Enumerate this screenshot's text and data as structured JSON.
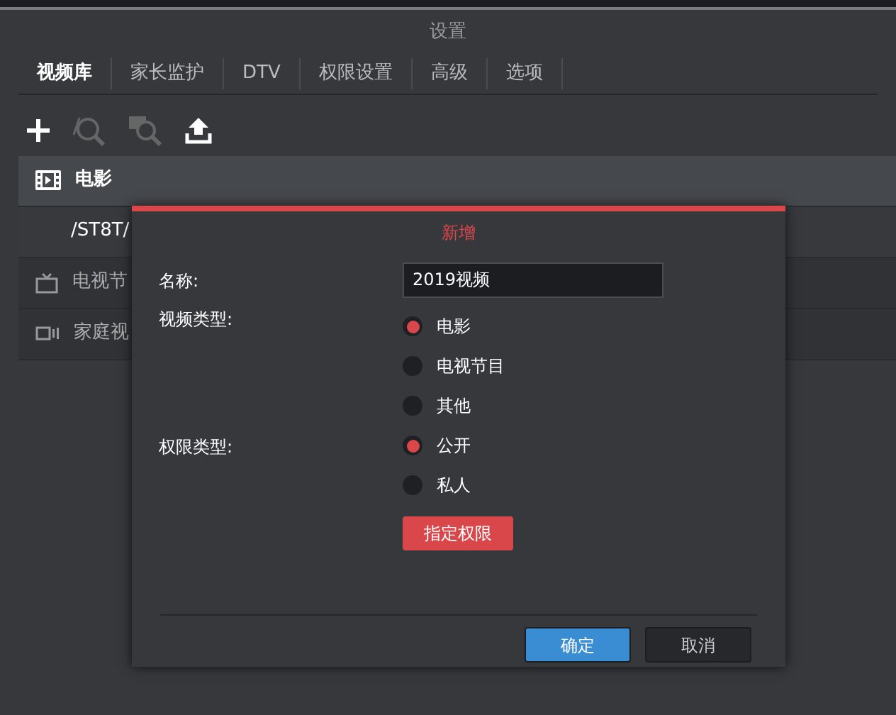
{
  "window": {
    "title": "设置"
  },
  "tabs": [
    {
      "label": "视频库",
      "selected": true
    },
    {
      "label": "家长监护",
      "selected": false
    },
    {
      "label": "DTV",
      "selected": false
    },
    {
      "label": "权限设置",
      "selected": false
    },
    {
      "label": "高级",
      "selected": false
    },
    {
      "label": "选项",
      "selected": false
    }
  ],
  "library": [
    {
      "kind": "movie",
      "label": "电影",
      "selected": true
    },
    {
      "kind": "path",
      "label": "/ST8T/",
      "selected": false
    },
    {
      "kind": "tv",
      "label": "电视节",
      "selected": false
    },
    {
      "kind": "home",
      "label": "家庭视",
      "selected": false
    }
  ],
  "dialog": {
    "title": "新增",
    "name_label": "名称:",
    "name_value": "2019视频",
    "video_type_label": "视频类型:",
    "video_types": [
      {
        "label": "电影",
        "selected": true
      },
      {
        "label": "电视节目",
        "selected": false
      },
      {
        "label": "其他",
        "selected": false
      }
    ],
    "permission_label": "权限类型:",
    "permissions": [
      {
        "label": "公开",
        "selected": true
      },
      {
        "label": "私人",
        "selected": false
      }
    ],
    "assign_button": "指定权限",
    "buttons": [
      {
        "kind": "primary",
        "label": "确定"
      },
      {
        "kind": "secondary",
        "label": "取消"
      }
    ]
  }
}
